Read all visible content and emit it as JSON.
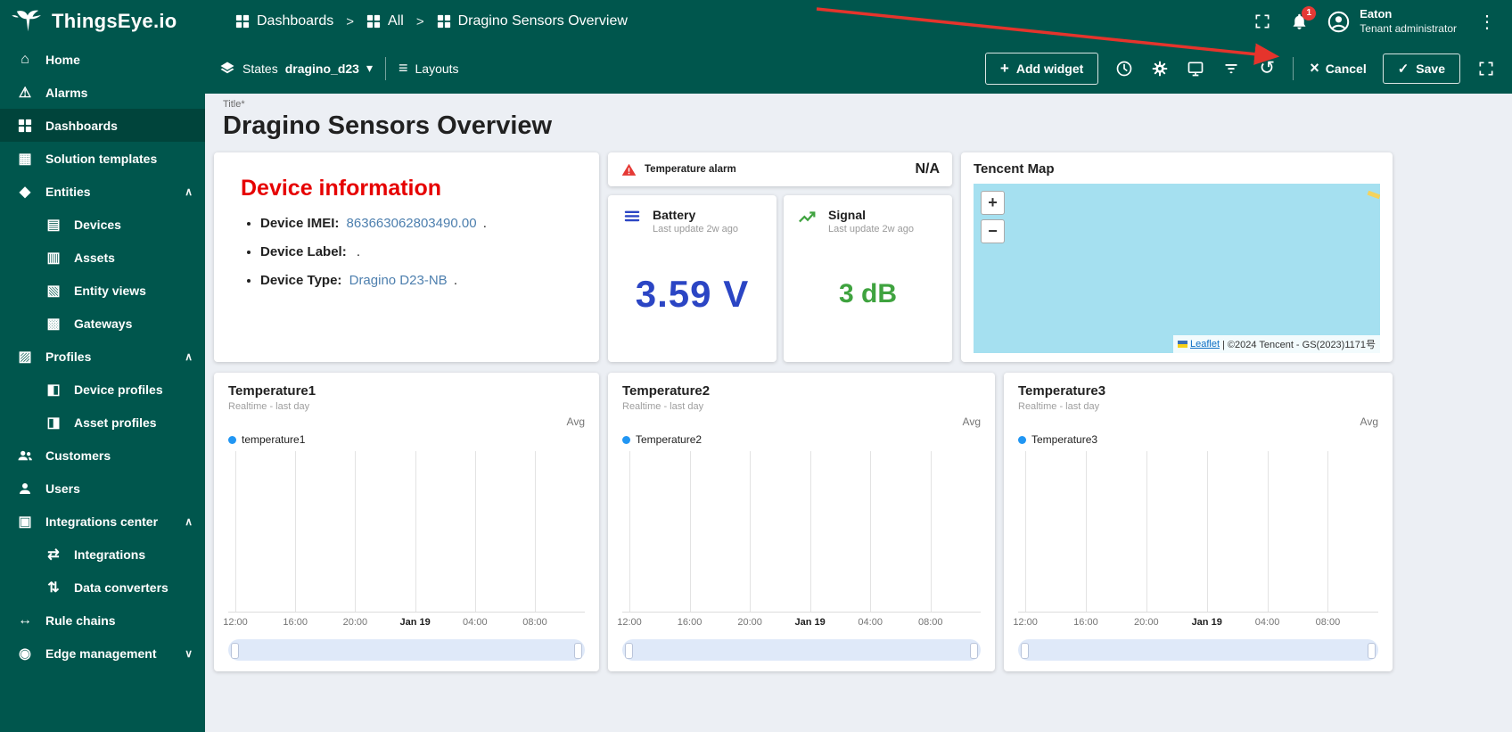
{
  "colors": {
    "brand_teal": "#00564d",
    "sidebar_active": "#00443b",
    "content_bg": "#eceff4",
    "heading_red": "#e60000",
    "link_blue": "#4d7fae",
    "battery_blue": "#2b45c4",
    "signal_green": "#3fa33f",
    "legend_dot_blue": "#2196f3",
    "map_water": "#a5e0f0",
    "annotation_arrow_red": "#e5342c"
  },
  "icons": {
    "home": "⌂",
    "alarm": "⚠",
    "entities": "◆",
    "devices": "▤",
    "assets": "▥",
    "entity_views": "▧",
    "gateways": "▩",
    "profiles": "▨",
    "device_profiles": "◧",
    "asset_profiles": "◨",
    "integrations_center": "▣",
    "integrations": "⇄",
    "data_converters": "⇅",
    "rule_chains": "↔",
    "edge_management": "◉",
    "solution_templates": "▦",
    "chevron_up": "∧",
    "chevron_down": "∨",
    "dropdown": "▾",
    "kebab": "⋮",
    "layouts": "≡",
    "history": "↺",
    "cancel": "×",
    "check": "✓",
    "add": "+"
  },
  "header": {
    "logo_text": "ThingsEye.io",
    "separator": ">",
    "breadcrumb": [
      {
        "label": "Dashboards"
      },
      {
        "label": "All"
      },
      {
        "label": "Dragino Sensors Overview"
      }
    ],
    "notification_count": "1",
    "user": {
      "name": "Eaton",
      "role": "Tenant administrator"
    }
  },
  "toolbar": {
    "states": {
      "label": "States",
      "value": "dragino_d23"
    },
    "layouts_label": "Layouts",
    "add_widget_label": "Add widget",
    "cancel_label": "Cancel",
    "save_label": "Save"
  },
  "sidebar": {
    "items": [
      {
        "label": "Home"
      },
      {
        "label": "Alarms"
      },
      {
        "label": "Dashboards"
      },
      {
        "label": "Solution templates"
      },
      {
        "label": "Entities"
      },
      {
        "label": "Devices"
      },
      {
        "label": "Assets"
      },
      {
        "label": "Entity views"
      },
      {
        "label": "Gateways"
      },
      {
        "label": "Profiles"
      },
      {
        "label": "Device profiles"
      },
      {
        "label": "Asset profiles"
      },
      {
        "label": "Customers"
      },
      {
        "label": "Users"
      },
      {
        "label": "Integrations center"
      },
      {
        "label": "Integrations"
      },
      {
        "label": "Data converters"
      },
      {
        "label": "Rule chains"
      },
      {
        "label": "Edge management"
      }
    ]
  },
  "page": {
    "title_label": "Title*",
    "title_value": "Dragino Sensors Overview"
  },
  "widgets": {
    "device_info": {
      "title": "Device information",
      "items": [
        {
          "label": "Device IMEI:",
          "value": "863663062803490.00",
          "suffix": "."
        },
        {
          "label": "Device Label:",
          "value": "",
          "suffix": "."
        },
        {
          "label": "Device Type:",
          "value": "Dragino D23-NB",
          "suffix": "."
        }
      ]
    },
    "alarm": {
      "label": "Temperature alarm",
      "value": "N/A"
    },
    "battery": {
      "title": "Battery",
      "subtitle": "Last update 2w ago",
      "value": "3.59 V"
    },
    "signal": {
      "title": "Signal",
      "subtitle": "Last update 2w ago",
      "value": "3 dB"
    },
    "map": {
      "title": "Tencent Map",
      "zoom_in": "+",
      "zoom_out": "−",
      "attribution_link": "Leaflet",
      "attribution_text": "| ©2024 Tencent - GS(2023)1171号"
    }
  },
  "chart_data": [
    {
      "type": "line",
      "title": "Temperature1",
      "subtitle": "Realtime - last day",
      "aggregation": "Avg",
      "legend": "temperature1",
      "x_ticks": [
        "12:00",
        "16:00",
        "20:00",
        "Jan 19",
        "04:00",
        "08:00"
      ],
      "series": [
        {
          "name": "temperature1",
          "values": []
        }
      ],
      "grid": true,
      "note": "no data points visible"
    },
    {
      "type": "line",
      "title": "Temperature2",
      "subtitle": "Realtime - last day",
      "aggregation": "Avg",
      "legend": "Temperature2",
      "x_ticks": [
        "12:00",
        "16:00",
        "20:00",
        "Jan 19",
        "04:00",
        "08:00"
      ],
      "series": [
        {
          "name": "Temperature2",
          "values": []
        }
      ],
      "grid": true,
      "note": "no data points visible"
    },
    {
      "type": "line",
      "title": "Temperature3",
      "subtitle": "Realtime - last day",
      "aggregation": "Avg",
      "legend": "Temperature3",
      "x_ticks": [
        "12:00",
        "16:00",
        "20:00",
        "Jan 19",
        "04:00",
        "08:00"
      ],
      "series": [
        {
          "name": "Temperature3",
          "values": []
        }
      ],
      "grid": true,
      "note": "no data points visible"
    }
  ]
}
